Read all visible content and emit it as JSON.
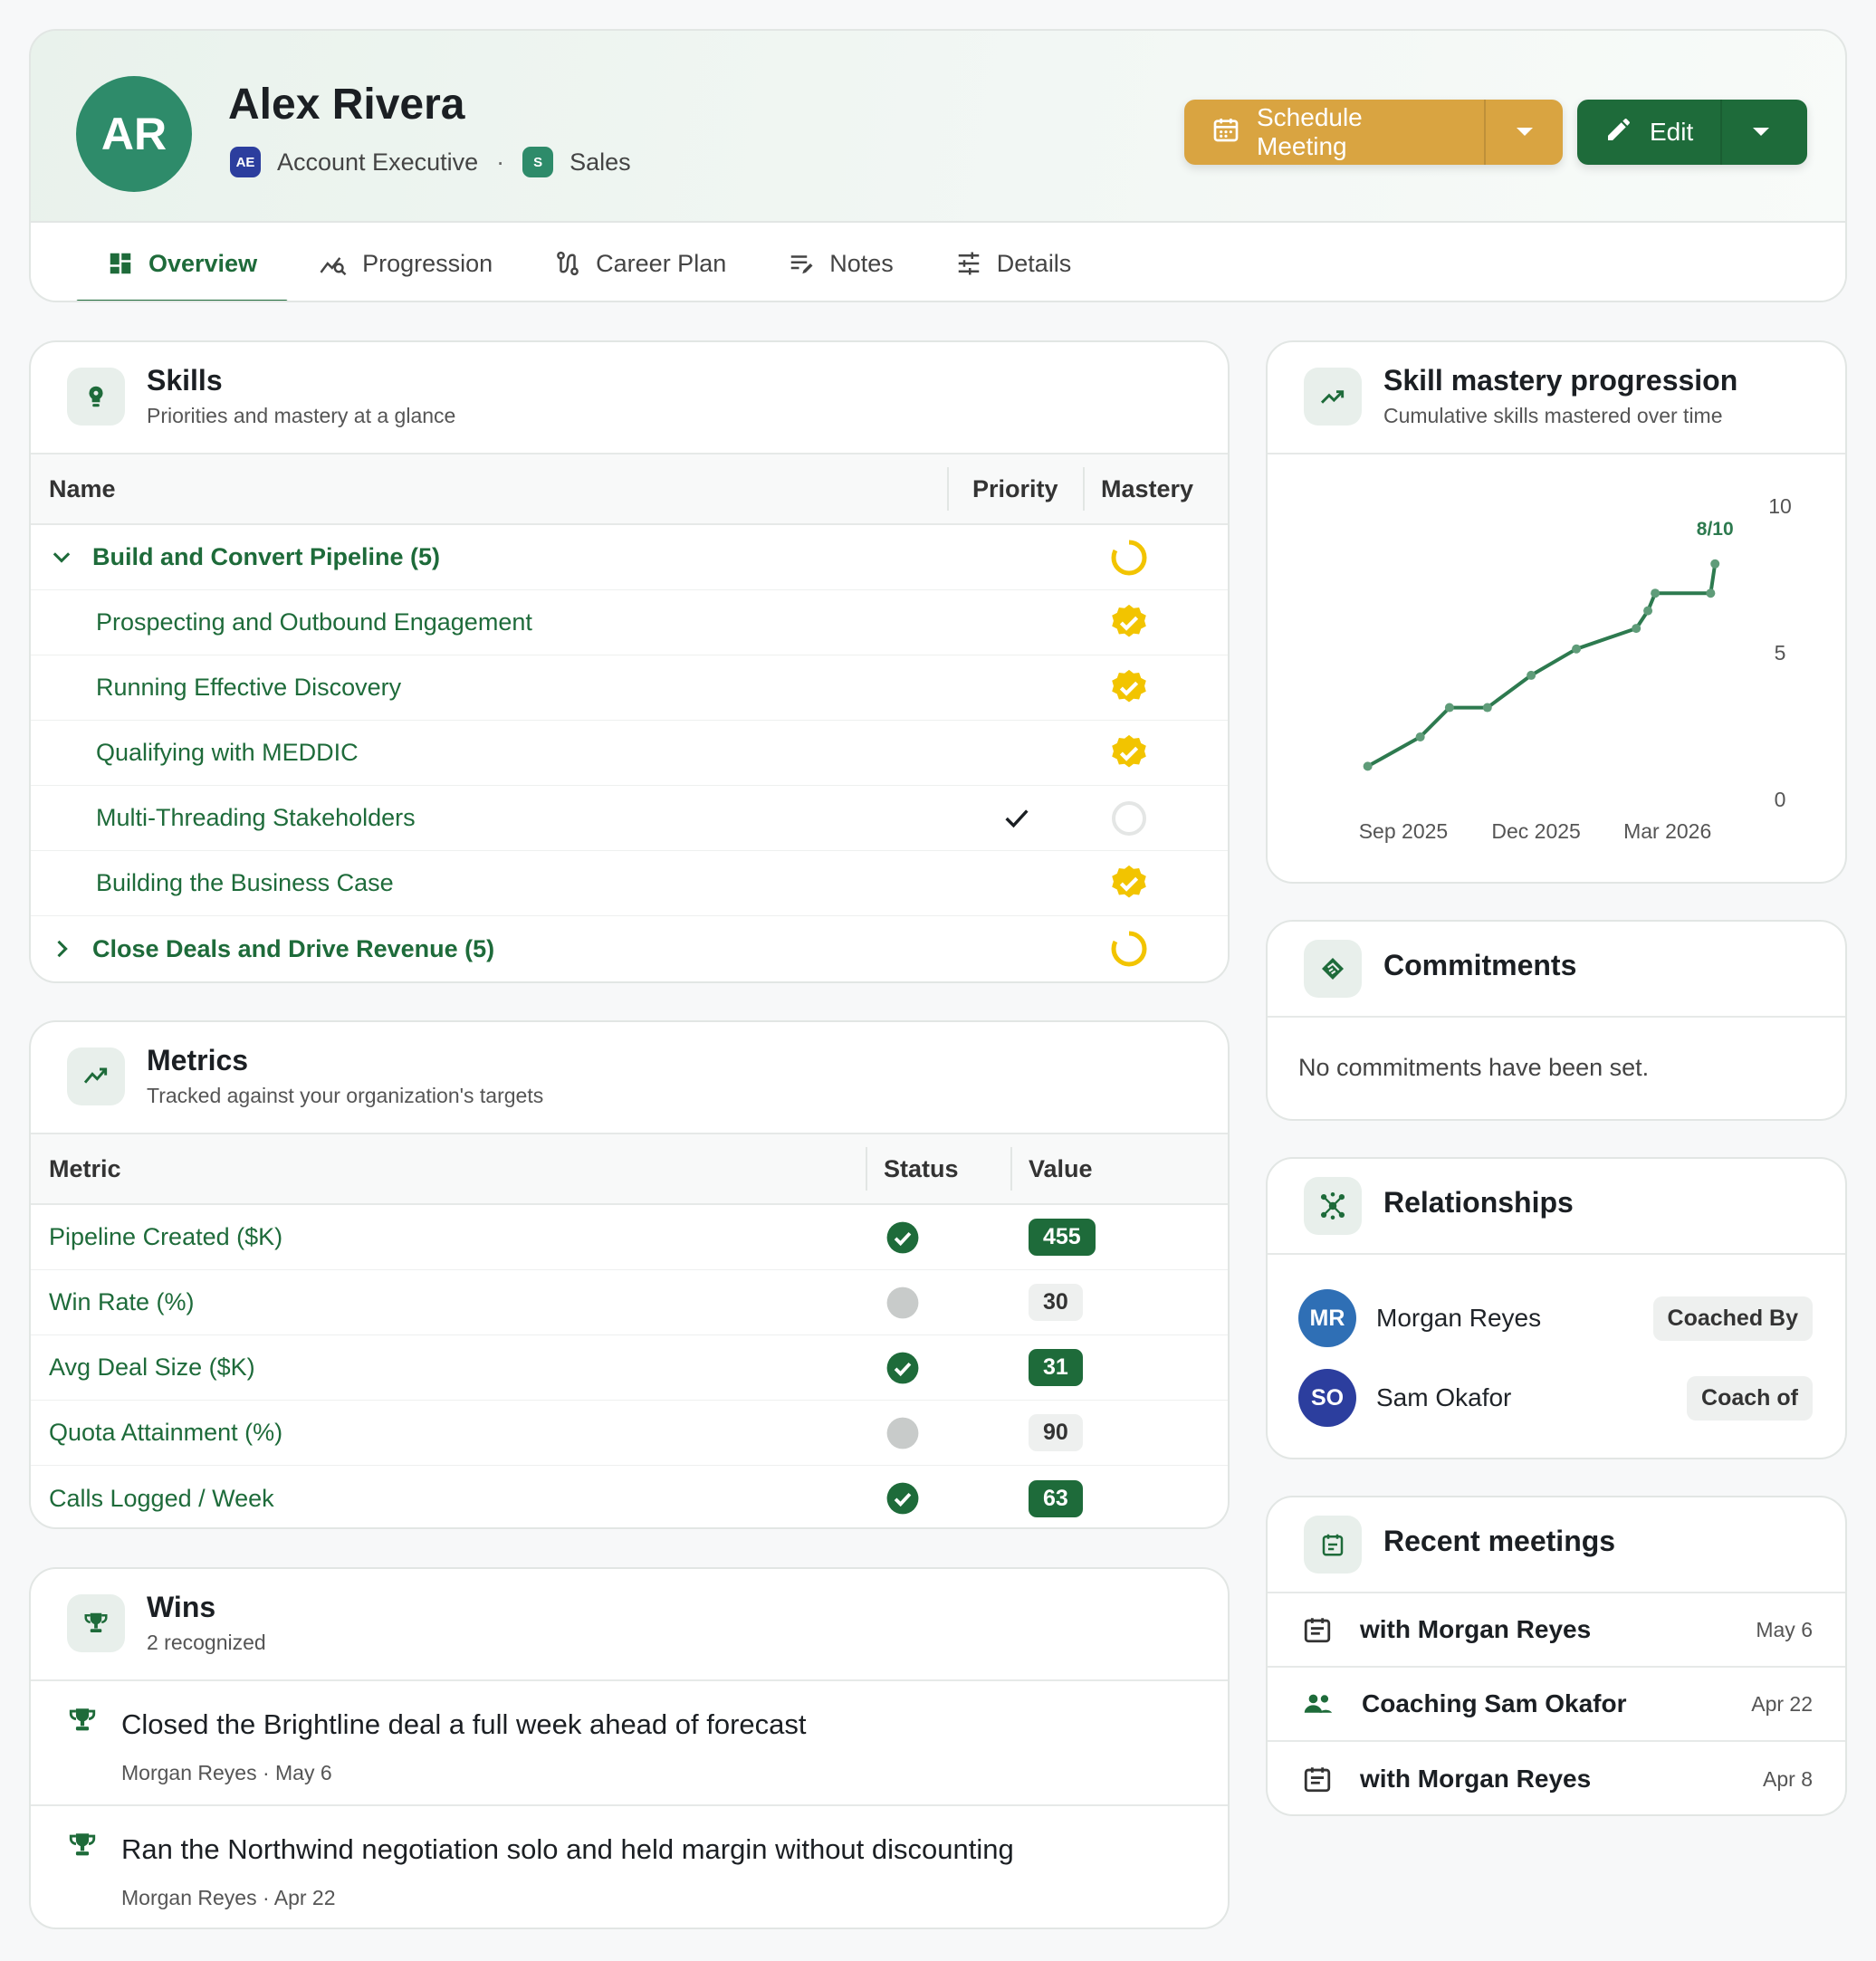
{
  "profile": {
    "initials": "AR",
    "name": "Alex Rivera",
    "role_badge": "AE",
    "role": "Account Executive",
    "dept_badge": "S",
    "dept": "Sales",
    "separator": "·"
  },
  "actions": {
    "schedule_label": "Schedule Meeting",
    "edit_label": "Edit"
  },
  "tabs": [
    {
      "label": "Overview",
      "icon": "dashboard-icon",
      "active": true
    },
    {
      "label": "Progression",
      "icon": "trend-search-icon"
    },
    {
      "label": "Career Plan",
      "icon": "route-icon"
    },
    {
      "label": "Notes",
      "icon": "notes-icon"
    },
    {
      "label": "Details",
      "icon": "tune-icon"
    }
  ],
  "skills": {
    "title": "Skills",
    "subtitle": "Priorities and mastery at a glance",
    "columns": {
      "name": "Name",
      "priority": "Priority",
      "mastery": "Mastery"
    },
    "groups": [
      {
        "label": "Build and Convert Pipeline (5)",
        "expanded": true,
        "mastery": "partial",
        "items": [
          {
            "label": "Prospecting and Outbound Engagement",
            "priority": false,
            "mastery": "mastered"
          },
          {
            "label": "Running Effective Discovery",
            "priority": false,
            "mastery": "mastered"
          },
          {
            "label": "Qualifying with MEDDIC",
            "priority": false,
            "mastery": "mastered"
          },
          {
            "label": "Multi-Threading Stakeholders",
            "priority": true,
            "mastery": "none"
          },
          {
            "label": "Building the Business Case",
            "priority": false,
            "mastery": "mastered"
          }
        ]
      },
      {
        "label": "Close Deals and Drive Revenue (5)",
        "expanded": false,
        "mastery": "partial"
      }
    ]
  },
  "metrics": {
    "title": "Metrics",
    "subtitle": "Tracked against your organization's targets",
    "columns": {
      "metric": "Metric",
      "status": "Status",
      "value": "Value"
    },
    "rows": [
      {
        "label": "Pipeline Created ($K)",
        "status": "met",
        "value": "455"
      },
      {
        "label": "Win Rate (%)",
        "status": "neutral",
        "value": "30"
      },
      {
        "label": "Avg Deal Size ($K)",
        "status": "met",
        "value": "31"
      },
      {
        "label": "Quota Attainment (%)",
        "status": "neutral",
        "value": "90"
      },
      {
        "label": "Calls Logged / Week",
        "status": "met",
        "value": "63"
      }
    ]
  },
  "wins": {
    "title": "Wins",
    "subtitle": "2 recognized",
    "items": [
      {
        "title": "Closed the Brightline deal a full week ahead of forecast",
        "meta": "Morgan Reyes · May 6"
      },
      {
        "title": "Ran the Northwind negotiation solo and held margin without discounting",
        "meta": "Morgan Reyes · Apr 22"
      }
    ]
  },
  "mastery_progression": {
    "title": "Skill mastery progression",
    "subtitle": "Cumulative skills mastered over time"
  },
  "chart_data": {
    "type": "line",
    "x_ticks": [
      "Sep 2025",
      "Dec 2025",
      "Mar 2026"
    ],
    "y_ticks": [
      "0",
      "5",
      "10"
    ],
    "ylim": [
      0,
      10
    ],
    "end_label": "8/10",
    "series": [
      {
        "points": [
          [
            "2025-08-20",
            1.1
          ],
          [
            "2025-09-25",
            2.1
          ],
          [
            "2025-10-15",
            3.1
          ],
          [
            "2025-11-10",
            3.1
          ],
          [
            "2025-12-10",
            4.2
          ],
          [
            "2026-01-10",
            5.1
          ],
          [
            "2026-02-20",
            5.8
          ],
          [
            "2026-02-28",
            6.4
          ],
          [
            "2026-03-05",
            7.0
          ],
          [
            "2026-04-12",
            7.0
          ],
          [
            "2026-04-15",
            8.0
          ]
        ]
      }
    ],
    "color": "#2d7a4f"
  },
  "commitments": {
    "title": "Commitments",
    "empty_text": "No commitments have been set."
  },
  "relationships": {
    "title": "Relationships",
    "items": [
      {
        "initials": "MR",
        "name": "Morgan Reyes",
        "relation": "Coached By",
        "color": "#2f6fb5"
      },
      {
        "initials": "SO",
        "name": "Sam Okafor",
        "relation": "Coach of",
        "color": "#2c3e9e"
      }
    ]
  },
  "meetings": {
    "title": "Recent meetings",
    "items": [
      {
        "title": "with Morgan Reyes",
        "date": "May 6",
        "icon": "calendar-icon"
      },
      {
        "title": "Coaching Sam Okafor",
        "date": "Apr 22",
        "icon": "people-icon"
      },
      {
        "title": "with Morgan Reyes",
        "date": "Apr 8",
        "icon": "calendar-icon"
      }
    ]
  },
  "colors": {
    "brand_green": "#1e6b3a",
    "accent_gold": "#d9a441",
    "mastery_yellow": "#f2c400"
  }
}
